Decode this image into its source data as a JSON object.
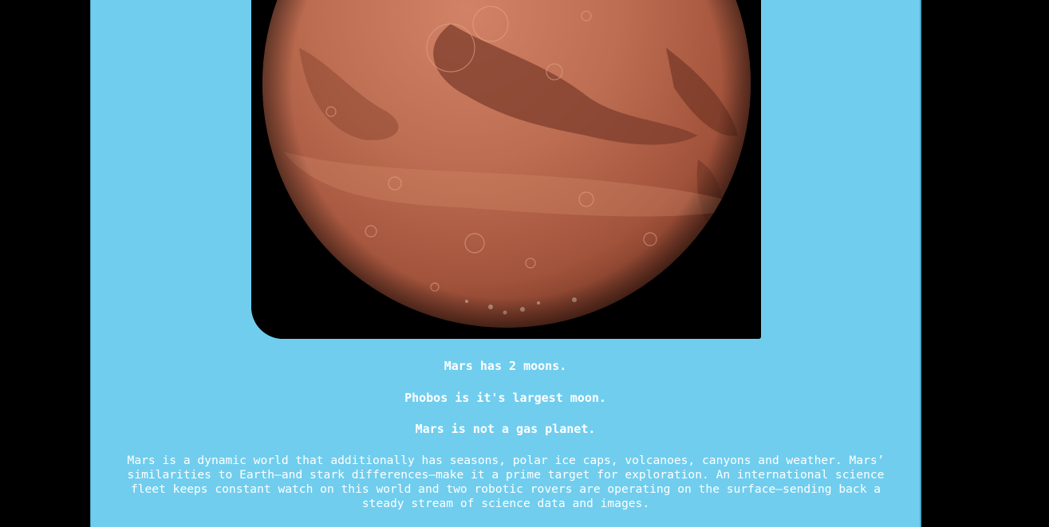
{
  "planet": {
    "image_alt": "Mars",
    "colors": {
      "panel": "#70cdee",
      "page": "#000000",
      "text": "#ffffff",
      "planet_base": "#b5674a"
    }
  },
  "facts": {
    "moons": "Mars has 2 moons.",
    "largest_moon": "Phobos is it's largest moon.",
    "gas": "Mars is not a gas planet."
  },
  "description": "Mars is a dynamic world that additionally has seasons, polar ice caps, volcanoes, canyons and weather. Mars’ similarities to Earth—and stark differences—make it a prime target for exploration. An international science fleet keeps constant watch on this world and two robotic rovers are operating on the surface—sending back a steady stream of science data and images."
}
